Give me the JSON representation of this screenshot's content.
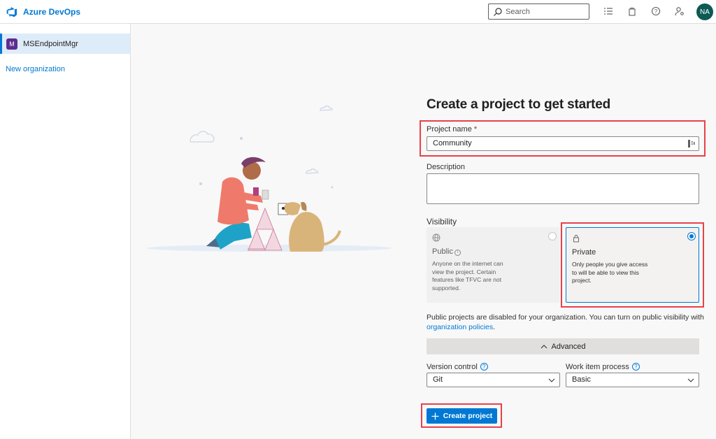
{
  "header": {
    "brand": "Azure DevOps",
    "search_placeholder": "Search",
    "icons": [
      "list-icon",
      "shopping-bag-icon",
      "help-icon",
      "user-settings-icon"
    ],
    "user_initials": "NA"
  },
  "sidebar": {
    "organization": {
      "initial": "M",
      "name": "MSEndpointMgr"
    },
    "new_org_link": "New organization"
  },
  "form": {
    "title": "Create a project to get started",
    "project_name_label": "Project name",
    "required_marker": "*",
    "project_name_value": "Community",
    "description_label": "Description",
    "description_value": "",
    "visibility_label": "Visibility",
    "visibility_options": [
      {
        "title": "Public",
        "desc": "Anyone on the internet can view the project. Certain features like TFVC are not supported.",
        "selected": false,
        "disabled": true
      },
      {
        "title": "Private",
        "desc": "Only people you give access to will be able to view this project.",
        "selected": true,
        "disabled": false
      }
    ],
    "notice_text": "Public projects are disabled for your organization. You can turn on public visibility with",
    "notice_link": "organization policies",
    "notice_end": ".",
    "advanced_label": "Advanced",
    "version_control_label": "Version control",
    "version_control_value": "Git",
    "work_item_label": "Work item process",
    "work_item_value": "Basic",
    "create_button": "Create project"
  },
  "colors": {
    "accent": "#0078d4",
    "highlight": "#e8414a",
    "org_avatar": "#5c2d91",
    "user_avatar": "#0b5a53"
  }
}
